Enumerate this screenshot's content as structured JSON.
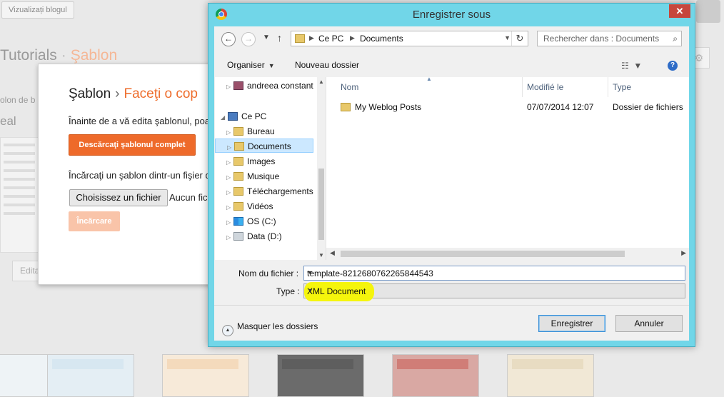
{
  "background": {
    "view_blog_button": "Vizualizați blogul",
    "breadcrumb_root": "Tutorials",
    "breadcrumb_sep": "·",
    "breadcrumb_current": "Şablon",
    "left_text_1": "olon de b",
    "left_text_2": "eal",
    "edit_button": "Edita"
  },
  "template_panel": {
    "title_root": "Şablon",
    "title_sep": "›",
    "title_current": "Faceţi o cop",
    "text_before_edit": "Înainte de a vă edita şablonul, poa",
    "download_button": "Descărcaţi şablonul complet",
    "upload_text": "Încărcaţi un şablon dintr-un fişier d",
    "choose_file_button": "Choisissez un fichier",
    "no_file_text": "Aucun fic",
    "upload_button": "Încărcare",
    "accent_color": "#ee6a2a"
  },
  "dialog": {
    "title": "Enregistrer sous",
    "close_label": "✕",
    "address_segments": [
      "Ce PC",
      "Documents"
    ],
    "search_placeholder": "Rechercher dans : Documents",
    "toolbar": {
      "organize": "Organiser",
      "new_folder": "Nouveau dossier"
    },
    "nav_tree": [
      {
        "label": "andreea constant",
        "icon": "user-icon"
      },
      {
        "label": "Ce PC",
        "icon": "computer-icon"
      },
      {
        "label": "Bureau",
        "icon": "folder-icon"
      },
      {
        "label": "Documents",
        "icon": "folder-icon"
      },
      {
        "label": "Images",
        "icon": "folder-icon"
      },
      {
        "label": "Musique",
        "icon": "folder-icon"
      },
      {
        "label": "Téléchargements",
        "icon": "folder-icon"
      },
      {
        "label": "Vidéos",
        "icon": "folder-icon"
      },
      {
        "label": "OS (C:)",
        "icon": "windows-drive-icon"
      },
      {
        "label": "Data (D:)",
        "icon": "drive-icon"
      }
    ],
    "columns": {
      "name": "Nom",
      "modified": "Modifié le",
      "type": "Type"
    },
    "files": [
      {
        "name": "My Weblog Posts",
        "modified": "07/07/2014 12:07",
        "type": "Dossier de fichiers"
      }
    ],
    "filename_label": "Nom du fichier :",
    "filename_value": "template-8212680762265844543",
    "type_label": "Type :",
    "type_value": "XML Document",
    "hide_folders": "Masquer les dossiers",
    "save_button": "Enregistrer",
    "cancel_button": "Annuler",
    "frame_color": "#71d6e8",
    "highlight_color": "#f5f500"
  }
}
